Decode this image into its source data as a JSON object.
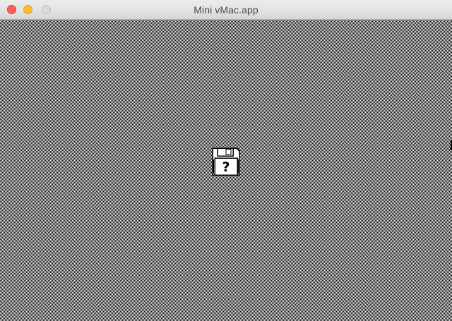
{
  "window": {
    "title": "Mini vMac.app",
    "buttons": {
      "close": {
        "icon": "close-dot",
        "color": "#fd5e57"
      },
      "minimize": {
        "icon": "minimize-dot",
        "color": "#febc2e"
      },
      "zoom": {
        "icon": "zoom-dot",
        "color": "#d9d9d9"
      }
    }
  },
  "emulator": {
    "desktop_pattern": "gray-dither",
    "boot_icon": {
      "icon": "question-mark-floppy-disk",
      "symbol": "?"
    }
  }
}
